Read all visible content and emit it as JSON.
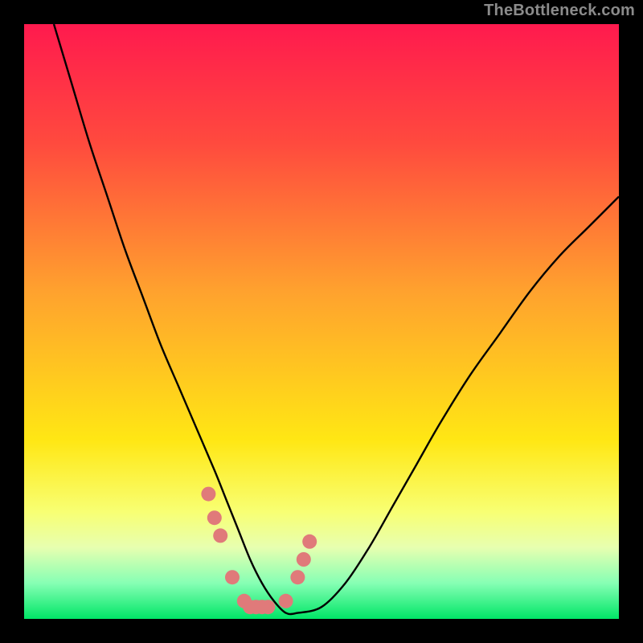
{
  "watermark": "TheBottleneck.com",
  "chart_data": {
    "type": "line",
    "title": "",
    "xlabel": "",
    "ylabel": "",
    "x_range": [
      0,
      100
    ],
    "y_range": [
      0,
      100
    ],
    "gradient_stops": [
      {
        "pos": 0.0,
        "color": "#ff1a4e"
      },
      {
        "pos": 0.2,
        "color": "#ff4a3e"
      },
      {
        "pos": 0.45,
        "color": "#ffa22e"
      },
      {
        "pos": 0.7,
        "color": "#ffe714"
      },
      {
        "pos": 0.82,
        "color": "#f8ff73"
      },
      {
        "pos": 0.88,
        "color": "#e7ffb0"
      },
      {
        "pos": 0.94,
        "color": "#86ffb4"
      },
      {
        "pos": 1.0,
        "color": "#00e667"
      }
    ],
    "curve": {
      "x": [
        5,
        8,
        11,
        14,
        17,
        20,
        23,
        26,
        29,
        32,
        34,
        36,
        38,
        40,
        42,
        44,
        46,
        50,
        54,
        58,
        62,
        66,
        70,
        75,
        80,
        85,
        90,
        95,
        100
      ],
      "y": [
        100,
        90,
        80,
        71,
        62,
        54,
        46,
        39,
        32,
        25,
        20,
        15,
        10,
        6,
        3,
        1,
        1,
        2,
        6,
        12,
        19,
        26,
        33,
        41,
        48,
        55,
        61,
        66,
        71
      ]
    },
    "dots": {
      "color": "#e07a7a",
      "x": [
        31,
        32,
        33,
        35,
        37,
        38,
        39,
        40,
        41,
        44,
        46,
        47,
        48
      ],
      "y": [
        21,
        17,
        14,
        7,
        3,
        2,
        2,
        2,
        2,
        3,
        7,
        10,
        13
      ]
    }
  }
}
